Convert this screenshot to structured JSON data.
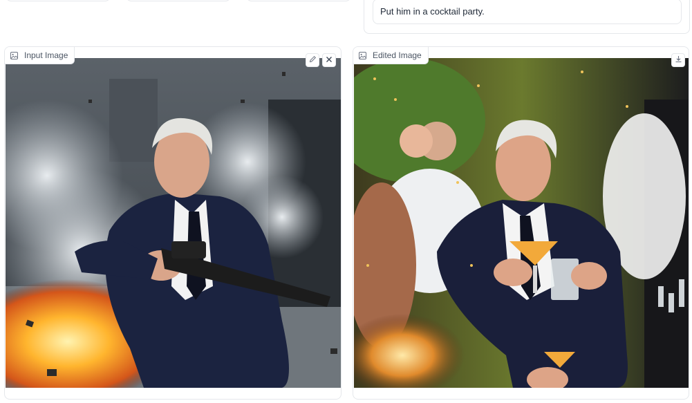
{
  "prompt": {
    "text": "Put him in a cocktail party."
  },
  "input_panel": {
    "label": "Input Image",
    "image_alt": "Man in a dark suit holding a rifle in front of an explosion with smoke and debris"
  },
  "output_panel": {
    "label": "Edited Image",
    "image_alt": "Man in a dark suit holding cocktail glasses at a party with guests and a bar in the background"
  },
  "icons": {
    "input_label": "image-icon",
    "output_label": "image-icon",
    "edit": "pencil-icon",
    "clear": "close-icon",
    "download": "download-icon"
  },
  "colors": {
    "border": "#e5e7eb",
    "label_text": "#4b5563",
    "prompt_text": "#1f2937"
  }
}
